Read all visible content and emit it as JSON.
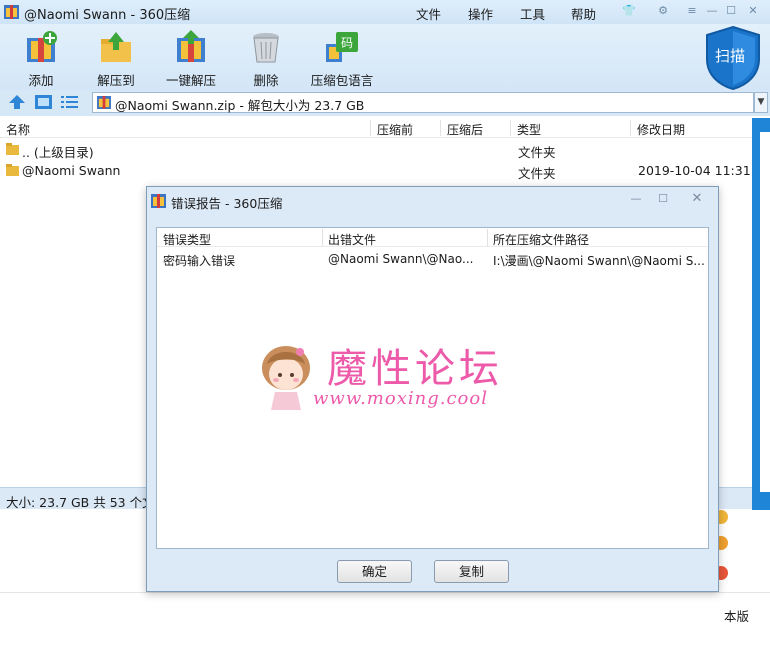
{
  "window": {
    "title": "@Naomi Swann - 360压缩",
    "menu": [
      "文件",
      "操作",
      "工具",
      "帮助"
    ]
  },
  "toolbar": {
    "items": [
      {
        "label": "添加",
        "icon": "add-archive-icon"
      },
      {
        "label": "解压到",
        "icon": "extract-to-icon"
      },
      {
        "label": "一键解压",
        "icon": "one-click-extract-icon"
      },
      {
        "label": "删除",
        "icon": "trash-can-icon"
      },
      {
        "label": "压缩包语言",
        "icon": "archive-language-icon",
        "badge": "码"
      }
    ],
    "scan_label": "扫描"
  },
  "address": {
    "value": "@Naomi Swann.zip - 解包大小为 23.7 GB"
  },
  "file_list": {
    "columns": [
      "名称",
      "压缩前",
      "压缩后",
      "类型",
      "修改日期"
    ],
    "rows": [
      {
        "name": ".. (上级目录)",
        "type": "文件夹",
        "date": ""
      },
      {
        "name": "@Naomi Swann",
        "type": "文件夹",
        "date": "2019-10-04 11:31"
      }
    ]
  },
  "status": {
    "text": "大小: 23.7 GB 共 53 个文"
  },
  "lower_panel": {
    "text": "本版"
  },
  "dialog": {
    "title": "错误报告 - 360压缩",
    "columns": [
      "错误类型",
      "出错文件",
      "所在压缩文件路径"
    ],
    "rows": [
      {
        "type": "密码输入错误",
        "file": "@Naomi Swann\\@Nao...",
        "path": "I:\\漫画\\@Naomi Swann\\@Naomi S..."
      }
    ],
    "ok_label": "确定",
    "copy_label": "复制"
  },
  "watermark": {
    "title": "魔性论坛",
    "url": "www.moxing.cool"
  },
  "colors": {
    "accent_blue": "#1f85d6",
    "watermark_pink": "#ec5aa9"
  }
}
